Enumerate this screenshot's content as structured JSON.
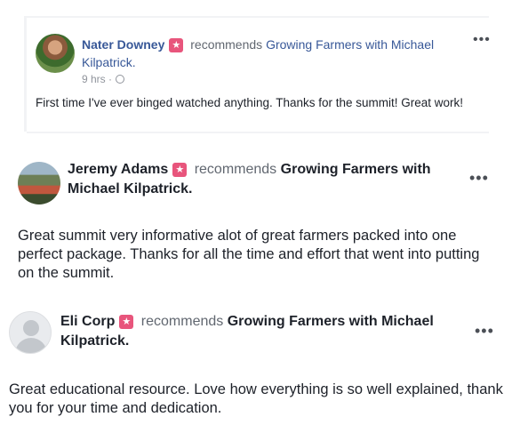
{
  "reviews": [
    {
      "name": "Nater Downey",
      "action": "recommends",
      "page": "Growing Farmers with Michael Kilpatrick.",
      "time": "9 hrs ·",
      "text": "First time I've ever binged watched anything. Thanks for the summit! Great work!"
    },
    {
      "name": "Jeremy Adams",
      "action": "recommends",
      "page": "Growing Farmers with Michael Kilpatrick.",
      "text": "Great summit very informative alot of great farmers packed into one perfect package. Thanks for all the time and effort that went into putting on the summit."
    },
    {
      "name": "Eli Corp",
      "action": "recommends",
      "page": "Growing Farmers with Michael Kilpatrick.",
      "text": "Great educational resource. Love how everything is  so well explained, thank you for your time and dedication."
    }
  ],
  "icons": {
    "more": "•••",
    "recommend_badge": "★",
    "privacy": "globe-icon"
  },
  "colors": {
    "link_blue": "#385898",
    "recommend_badge": "#e8557c",
    "meta_gray": "#616770"
  }
}
